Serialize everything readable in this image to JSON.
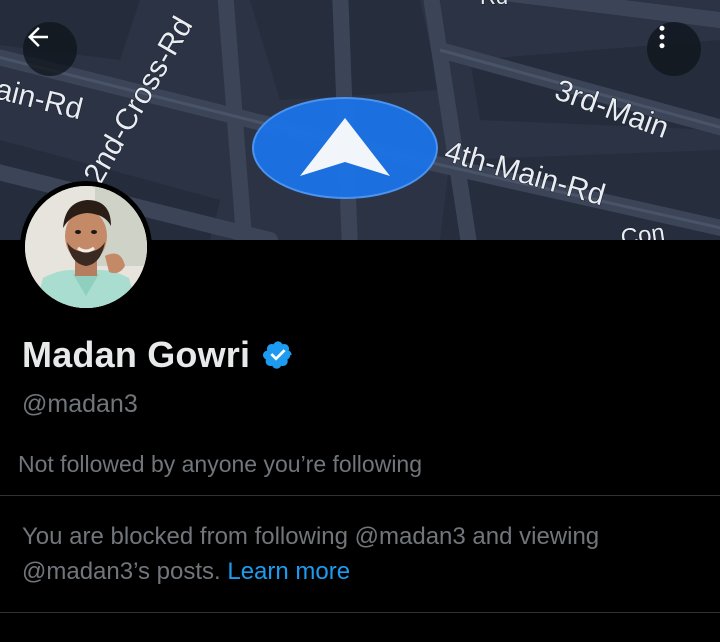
{
  "header": {
    "back_icon": "arrow-left-icon",
    "more_icon": "more-vertical-icon"
  },
  "banner": {
    "streets": {
      "main_rd": "ain-Rd",
      "cross_rd": "2nd-Cross-Rd",
      "third_main": "3rd-Main",
      "fourth_main": "4th-Main-Rd",
      "partial_top": "Rd",
      "partial_bottom": "Con"
    },
    "navigation_icon": "navigation-arrow-icon"
  },
  "profile": {
    "display_name": "Madan Gowri",
    "verified_icon": "verified-badge-icon",
    "handle": "@madan3",
    "followers_note": "Not followed by anyone you’re following"
  },
  "block_notice": {
    "text": "You are blocked from following @madan3 and viewing @madan3’s posts. ",
    "link_label": "Learn more"
  },
  "colors": {
    "background": "#000000",
    "primary_text": "#e7e9ea",
    "secondary_text": "#71767b",
    "accent": "#1d9bf0",
    "divider": "#2f3336",
    "map_background": "#2a3243",
    "nav_marker": "#1a73e8"
  }
}
